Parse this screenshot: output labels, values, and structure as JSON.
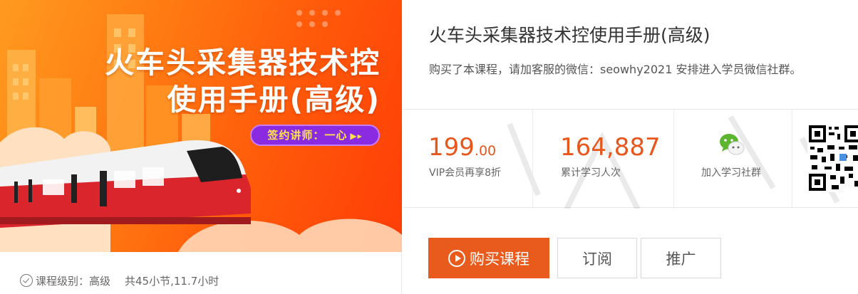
{
  "banner": {
    "title_line1": "火车头采集器技术控",
    "title_line2": "使用手册(高级)",
    "instructor": "签约讲师：一心"
  },
  "course_meta": {
    "level": "课程级别：高级",
    "sections": "共45小节,11.7小时"
  },
  "course": {
    "title": "火车头采集器技术控使用手册(高级)",
    "description": "购买了本课程，请加客服的微信：seowhy2021 安排进入学员微信社群。"
  },
  "stats": {
    "price_int": "199",
    "price_dec": ".00",
    "price_note": "VIP会员再享8折",
    "learners": "164,887",
    "learners_label": "累计学习人次",
    "community_label": "加入学习社群"
  },
  "buttons": {
    "buy": "购买课程",
    "subscribe": "订阅",
    "promote": "推广"
  },
  "colors": {
    "accent": "#e95b1d",
    "price": "#e8561b",
    "wechat": "#5bb530"
  }
}
